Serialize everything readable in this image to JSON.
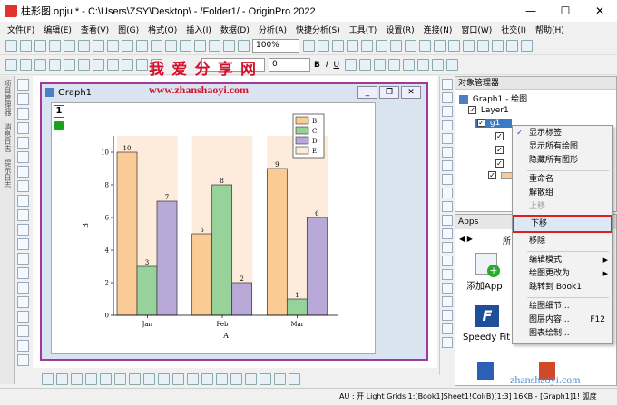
{
  "window": {
    "title": "柱形图.opju * - C:\\Users\\ZSY\\Desktop\\ - /Folder1/ - OriginPro 2022"
  },
  "menu": [
    "文件(F)",
    "编辑(E)",
    "查看(V)",
    "图(G)",
    "格式(O)",
    "插入(I)",
    "数据(D)",
    "分析(A)",
    "快捷分析(S)",
    "工具(T)",
    "设置(R)",
    "连接(N)",
    "窗口(W)",
    "社交(I)",
    "帮助(H)"
  ],
  "toolbar": {
    "zoom": "100%",
    "font_size": "0"
  },
  "watermark": {
    "top": "我 爱 分 享 网",
    "url": "www.zhanshaoyi.com",
    "corner": "zhanshaoyi.com"
  },
  "left_tabs": [
    "项目管理器",
    "消息日志",
    "提示日志"
  ],
  "graph": {
    "title": "Graph1",
    "layer": "1"
  },
  "object_manager": {
    "title": "对象管理器",
    "tree": {
      "root": "Graph1 - 绘图",
      "layer": "Layer1",
      "group": "g1"
    }
  },
  "apps": {
    "title": "Apps",
    "tab_partial": "所",
    "items": [
      "添加App",
      "Speedy Fit"
    ]
  },
  "context_menu": {
    "items": [
      "显示标签",
      "显示所有绘图",
      "隐藏所有图形",
      "重命名",
      "解散组",
      "上移",
      "下移",
      "移除",
      "编辑模式",
      "绘图更改为",
      "跳转到 Book1",
      "绘图细节...",
      "图层内容...",
      "图表绘制..."
    ],
    "shortcut_layer": "F12",
    "highlighted": "下移"
  },
  "status": "AU : 开  Light Grids 1:[Book1]Sheet1!Col(B)[1:3]  16KB - [Graph1]1! 弧度",
  "colors": {
    "accent": "#a03a9a",
    "highlight": "#e02020",
    "bar_b": "#fbcb95",
    "bar_c": "#97d29a",
    "bar_d": "#b9a9d9",
    "bar_e": "#fdecdc"
  },
  "chart_data": {
    "type": "bar",
    "categories": [
      "Jan",
      "Feb",
      "Mar"
    ],
    "xlabel": "A",
    "ylabel": "B",
    "ylim": [
      0,
      11
    ],
    "yticks": [
      0,
      2,
      4,
      6,
      8,
      10
    ],
    "legend": "top-right",
    "series": [
      {
        "name": "B",
        "values": [
          10,
          5,
          9
        ]
      },
      {
        "name": "C",
        "values": [
          3,
          8,
          1
        ]
      },
      {
        "name": "D",
        "values": [
          7,
          2,
          6
        ]
      },
      {
        "name": "E",
        "values": [
          null,
          null,
          null
        ]
      }
    ]
  }
}
